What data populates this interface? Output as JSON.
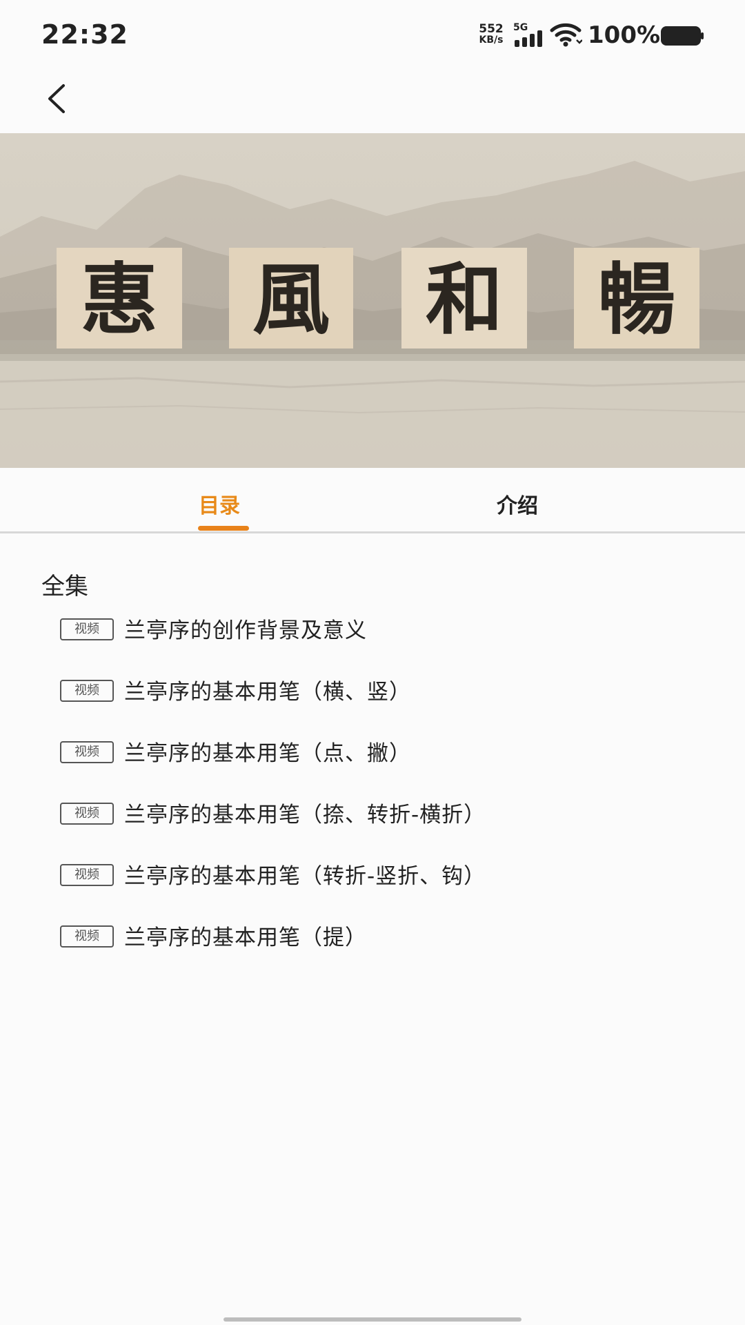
{
  "status_bar": {
    "time": "22:32",
    "net_speed_value": "552",
    "net_speed_unit": "KB/s",
    "network_type": "5G",
    "battery_percent": "100%",
    "battery_level": 1.0
  },
  "banner": {
    "calligraphy": [
      "惠",
      "風",
      "和",
      "暢"
    ]
  },
  "tabs": [
    {
      "label": "目录",
      "active": true
    },
    {
      "label": "介绍",
      "active": false
    }
  ],
  "colors": {
    "accent": "#e8821a",
    "text": "#222222",
    "badge": "#555555"
  },
  "section": {
    "title": "全集"
  },
  "episodes": [
    {
      "badge": "视频",
      "title": "兰亭序的创作背景及意义"
    },
    {
      "badge": "视频",
      "title": "兰亭序的基本用笔（横、竖）"
    },
    {
      "badge": "视频",
      "title": "兰亭序的基本用笔（点、撇）"
    },
    {
      "badge": "视频",
      "title": "兰亭序的基本用笔（捺、转折-横折）"
    },
    {
      "badge": "视频",
      "title": "兰亭序的基本用笔（转折-竖折、钩）"
    },
    {
      "badge": "视频",
      "title": "兰亭序的基本用笔（提）"
    }
  ],
  "icons": {
    "back": "chevron-left-icon",
    "wifi": "wifi-icon",
    "signal": "signal-icon",
    "battery": "battery-icon"
  }
}
